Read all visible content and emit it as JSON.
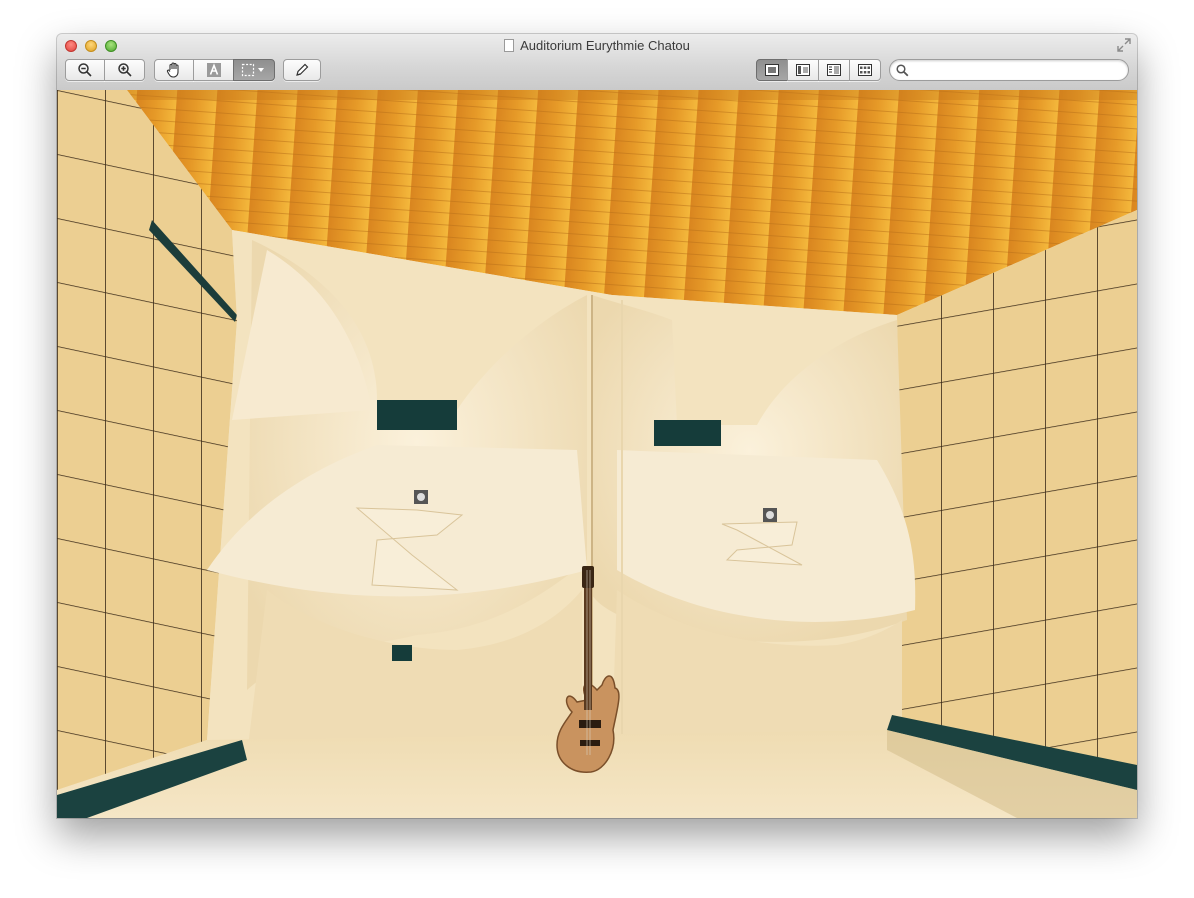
{
  "window": {
    "title": "Auditorium Eurythmie Chatou",
    "document_icon": "document-icon"
  },
  "toolbar": {
    "zoom_out_icon": "zoom-out-icon",
    "zoom_in_icon": "zoom-in-icon",
    "move_tool_icon": "hand-icon",
    "text_tool_icon": "text-select-icon",
    "select_tool_icon": "rect-select-icon",
    "annotate_icon": "pencil-icon",
    "view_buttons": [
      "content-only-icon",
      "thumbnails-icon",
      "table-of-contents-icon",
      "contact-sheet-icon"
    ],
    "search": {
      "value": "",
      "placeholder": "",
      "icon": "search-icon"
    }
  },
  "colors": {
    "ceiling": "#e8a030",
    "wall_panels": "#e9cf94",
    "acoustic_forms": "#f4e6c6",
    "dark_accent": "#1a4a45"
  },
  "viewer": {
    "image_subject": "auditorium-photo"
  }
}
